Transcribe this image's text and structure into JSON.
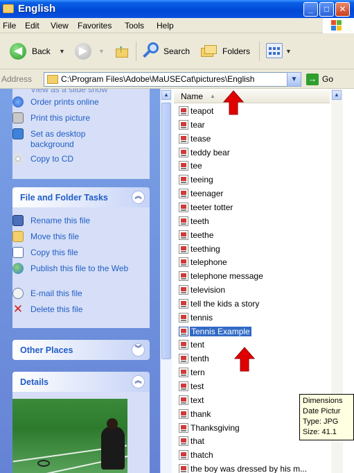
{
  "window": {
    "title": "English"
  },
  "menu": [
    "File",
    "Edit",
    "View",
    "Favorites",
    "Tools",
    "Help"
  ],
  "toolbar": {
    "back": "Back",
    "search": "Search",
    "folders": "Folders"
  },
  "address": {
    "label": "Address",
    "path": "C:\\Program Files\\Adobe\\MaUSECat\\pictures\\English",
    "go": "Go"
  },
  "picture_tasks": {
    "partial_item": "View as a slide show",
    "items": [
      {
        "label": "Order prints online",
        "icon": "order-prints-icon"
      },
      {
        "label": "Print this picture",
        "icon": "printer-icon"
      },
      {
        "label": "Set as desktop background",
        "icon": "desktop-background-icon"
      },
      {
        "label": "Copy to CD",
        "icon": "cd-icon"
      }
    ]
  },
  "file_tasks": {
    "title": "File and Folder Tasks",
    "items": [
      {
        "label": "Rename this file",
        "icon": "rename-icon"
      },
      {
        "label": "Move this file",
        "icon": "move-icon"
      },
      {
        "label": "Copy this file",
        "icon": "copy-icon"
      },
      {
        "label": "Publish this file to the Web",
        "icon": "globe-icon"
      },
      {
        "label": "E-mail this file",
        "icon": "email-icon"
      },
      {
        "label": "Delete this file",
        "icon": "delete-icon"
      }
    ]
  },
  "other_places": {
    "title": "Other Places"
  },
  "details": {
    "title": "Details"
  },
  "list": {
    "column": "Name",
    "files": [
      "teapot",
      "tear",
      "tease",
      "teddy bear",
      "tee",
      "teeing",
      "teenager",
      "teeter totter",
      "teeth",
      "teethe",
      "teething",
      "telephone",
      "telephone message",
      "television",
      "tell the kids a story",
      "tennis",
      "Tennis Example",
      "tent",
      "tenth",
      "tern",
      "test",
      "text",
      "thank",
      "Thanksgiving",
      "that",
      "thatch",
      "the boy was dressed by his m..."
    ],
    "selected": "Tennis Example"
  },
  "tooltip": [
    "Dimensions",
    "Date Pictur",
    "Type: JPG",
    "Size: 41.1"
  ],
  "colors": {
    "title_bar": "#0a52e0",
    "task_link": "#215dc6",
    "selection": "#316ac5",
    "arrow": "#e00000"
  }
}
